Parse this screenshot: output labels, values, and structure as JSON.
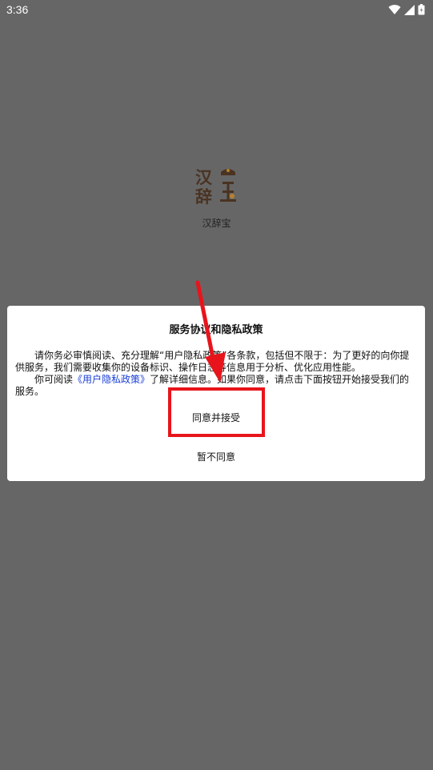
{
  "status_bar": {
    "time": "3:36"
  },
  "app": {
    "name": "汉辞宝",
    "logo_text_top": "汉",
    "logo_text_bottom": "辞"
  },
  "dialog": {
    "title": "服务协议和隐私政策",
    "paragraph1": "请你务必审慎阅读、充分理解“用户隐私政策”各条款，包括但不限于：为了更好的向你提供服务，我们需要收集你的设备标识、操作日志等信息用于分析、优化应用性能。",
    "paragraph2_prefix": "你可阅读",
    "paragraph2_link": "《用户隐私政策》",
    "paragraph2_suffix": "了解详细信息。如果你同意，请点击下面按钮开始接受我们的服务。",
    "agree_label": "同意并接受",
    "disagree_label": "暂不同意"
  },
  "annotation": {
    "color": "#e8141b"
  },
  "colors": {
    "overlay_background": "#666666",
    "dialog_background": "#ffffff",
    "link": "#1a3fd6",
    "logo_brown": "#4a3322",
    "logo_gold": "#b5832e"
  },
  "icons": [
    "wifi-icon",
    "cell-signal-icon",
    "battery-icon"
  ]
}
